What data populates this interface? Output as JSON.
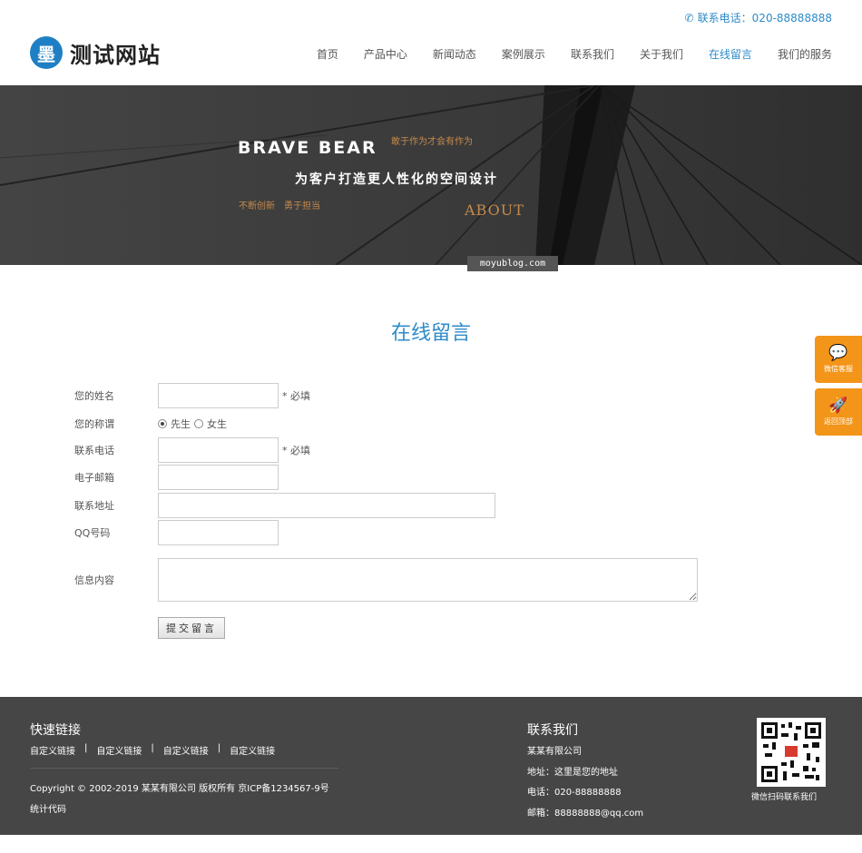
{
  "header": {
    "phone_label": "联系电话：020-88888888",
    "logo_mark": "墨",
    "logo_text": "测试网站",
    "nav": [
      {
        "label": "首页",
        "active": false
      },
      {
        "label": "产品中心",
        "active": false
      },
      {
        "label": "新闻动态",
        "active": false
      },
      {
        "label": "案例展示",
        "active": false
      },
      {
        "label": "联系我们",
        "active": false
      },
      {
        "label": "关于我们",
        "active": false
      },
      {
        "label": "在线留言",
        "active": true
      },
      {
        "label": "我们的服务",
        "active": false
      }
    ]
  },
  "banner": {
    "title": "BRAVE BEAR",
    "slogan": "敢于作为才会有作为",
    "subtitle": "为客户打造更人性化的空间设计",
    "tags": "不断创新　勇于担当",
    "about": "ABOUT",
    "watermark": "moyublog.com"
  },
  "page_title": "在线留言",
  "form": {
    "name_label": "您的姓名",
    "title_label": "您的称谓",
    "title_options": [
      "先生",
      "女生"
    ],
    "title_selected": "先生",
    "phone_label": "联系电话",
    "email_label": "电子邮箱",
    "address_label": "联系地址",
    "qq_label": "QQ号码",
    "message_label": "信息内容",
    "required_note": "* 必填",
    "submit_label": "提交留言",
    "name_value": "",
    "phone_value": "",
    "email_value": "",
    "address_value": "",
    "qq_value": "",
    "message_value": ""
  },
  "floating": {
    "wechat_label": "微信客服",
    "top_label": "返回顶部"
  },
  "footer": {
    "links_heading": "快速链接",
    "links": [
      "自定义链接",
      "自定义链接",
      "自定义链接",
      "自定义链接"
    ],
    "copyright": "Copyright © 2002-2019 某某有限公司 版权所有 京ICP备1234567-9号",
    "stats": "统计代码",
    "contact_heading": "联系我们",
    "company": "某某有限公司",
    "address": "地址：这里是您的地址",
    "phone": "电话：020-88888888",
    "email": "邮箱：88888888@qq.com",
    "qr_caption": "微信扫码联系我们"
  },
  "colors": {
    "accent": "#2e8bc9",
    "banner_gold": "#c48a4c",
    "float_orange": "#f39519",
    "footer_bg": "#464646"
  }
}
